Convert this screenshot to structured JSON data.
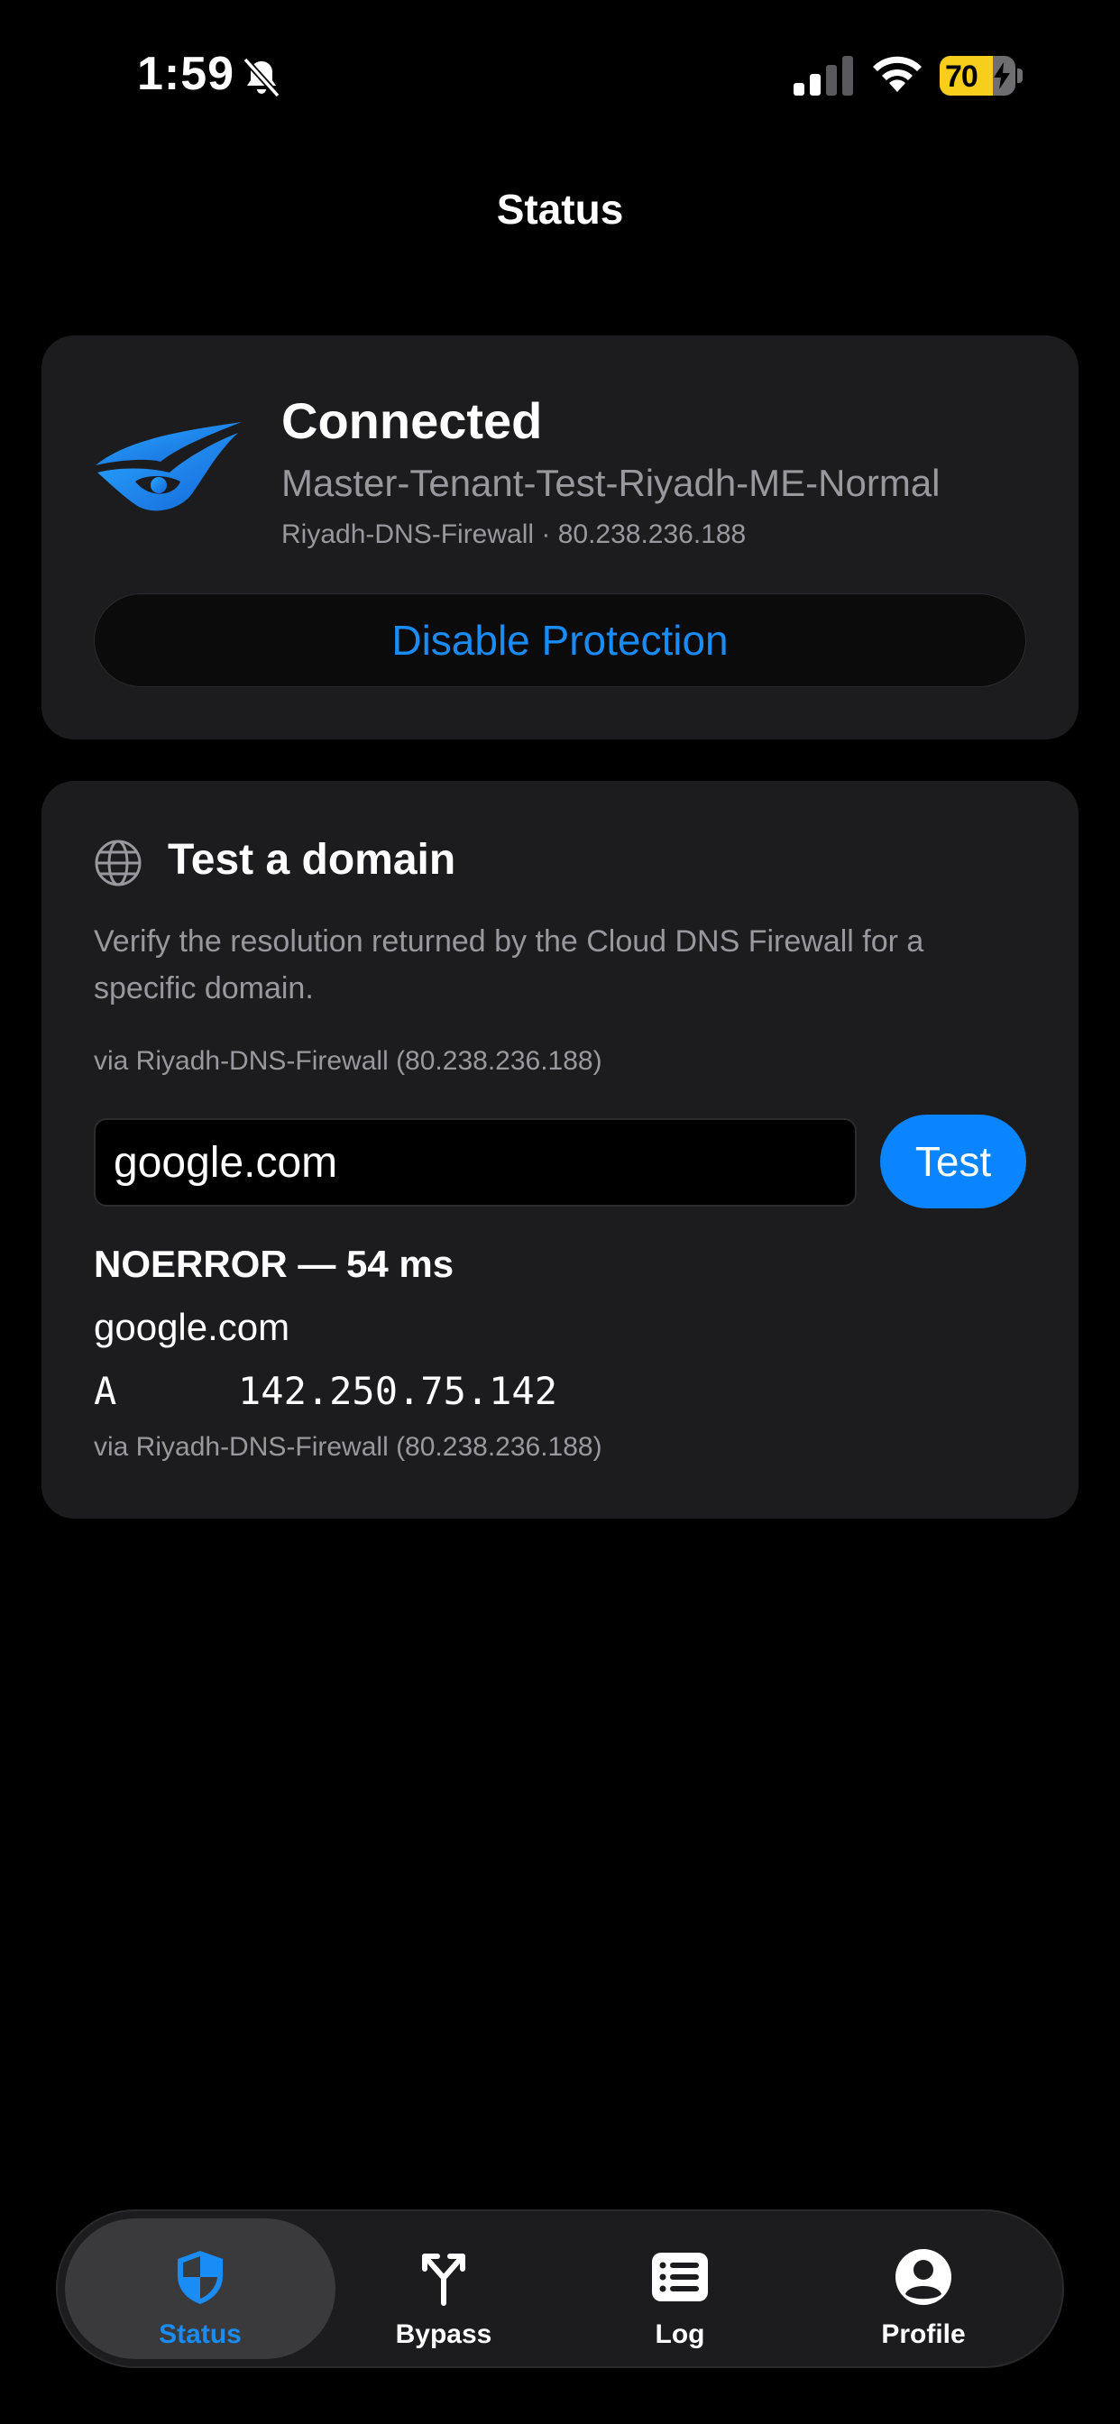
{
  "status_bar": {
    "time": "1:59",
    "battery_level": "70",
    "battery_fraction": 0.7
  },
  "nav": {
    "title": "Status"
  },
  "status_card": {
    "title": "Connected",
    "profile": "Master-Tenant-Test-Riyadh-ME-Normal",
    "server": "Riyadh-DNS-Firewall · 80.238.236.188",
    "disable_label": "Disable Protection"
  },
  "test_card": {
    "title": "Test a domain",
    "description": "Verify the resolution returned by the Cloud DNS Firewall for a specific domain.",
    "via": "via Riyadh-DNS-Firewall (80.238.236.188)",
    "input_value": "google.com",
    "test_label": "Test",
    "result": {
      "status": "NOERROR — 54 ms",
      "domain": "google.com",
      "record_type": "A",
      "record_value": "142.250.75.142",
      "via": "via Riyadh-DNS-Firewall (80.238.236.188)"
    }
  },
  "tabs": [
    {
      "label": "Status",
      "icon": "shield-icon",
      "active": true
    },
    {
      "label": "Bypass",
      "icon": "fork-icon",
      "active": false
    },
    {
      "label": "Log",
      "icon": "list-icon",
      "active": false
    },
    {
      "label": "Profile",
      "icon": "person-icon",
      "active": false
    }
  ],
  "colors": {
    "accent": "#0a84ff",
    "link": "#1a8cf5",
    "card": "#1c1c1e",
    "secondary_text": "#98989e",
    "battery": "#f7ce1c"
  }
}
